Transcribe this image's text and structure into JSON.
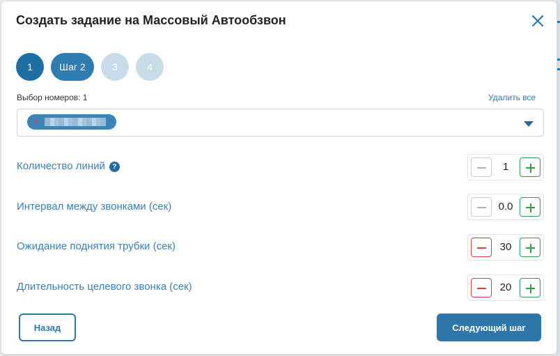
{
  "modal": {
    "title": "Создать задание на Массовый Автообзвон"
  },
  "steps": [
    {
      "label": "1",
      "state": "active"
    },
    {
      "label": "Шаг 2",
      "state": "done"
    },
    {
      "label": "3",
      "state": "todo"
    },
    {
      "label": "4",
      "state": "todo"
    }
  ],
  "numbers": {
    "label": "Выбор номеров: 1",
    "delete_all": "Удалить все",
    "chip_remove": "×"
  },
  "settings": [
    {
      "label": "Количество линий",
      "value": "1",
      "help": "?"
    },
    {
      "label": "Интервал между звонками (сек)",
      "value": "0.0"
    },
    {
      "label": "Ожидание поднятия трубки (сек)",
      "value": "30"
    },
    {
      "label": "Длительность целевого звонка (сек)",
      "value": "20"
    }
  ],
  "footer": {
    "back_label": "Назад",
    "next_label": "Следующий шаг"
  },
  "colors": {
    "primary": "#2f76a9",
    "plus": "#2ea04a",
    "minus_active": "#d64040",
    "label": "#3b80b2"
  },
  "icons": {
    "close": "close-icon",
    "dropdown": "chevron-down-icon",
    "help": "help-icon",
    "minus": "minus-icon",
    "plus": "plus-icon"
  }
}
